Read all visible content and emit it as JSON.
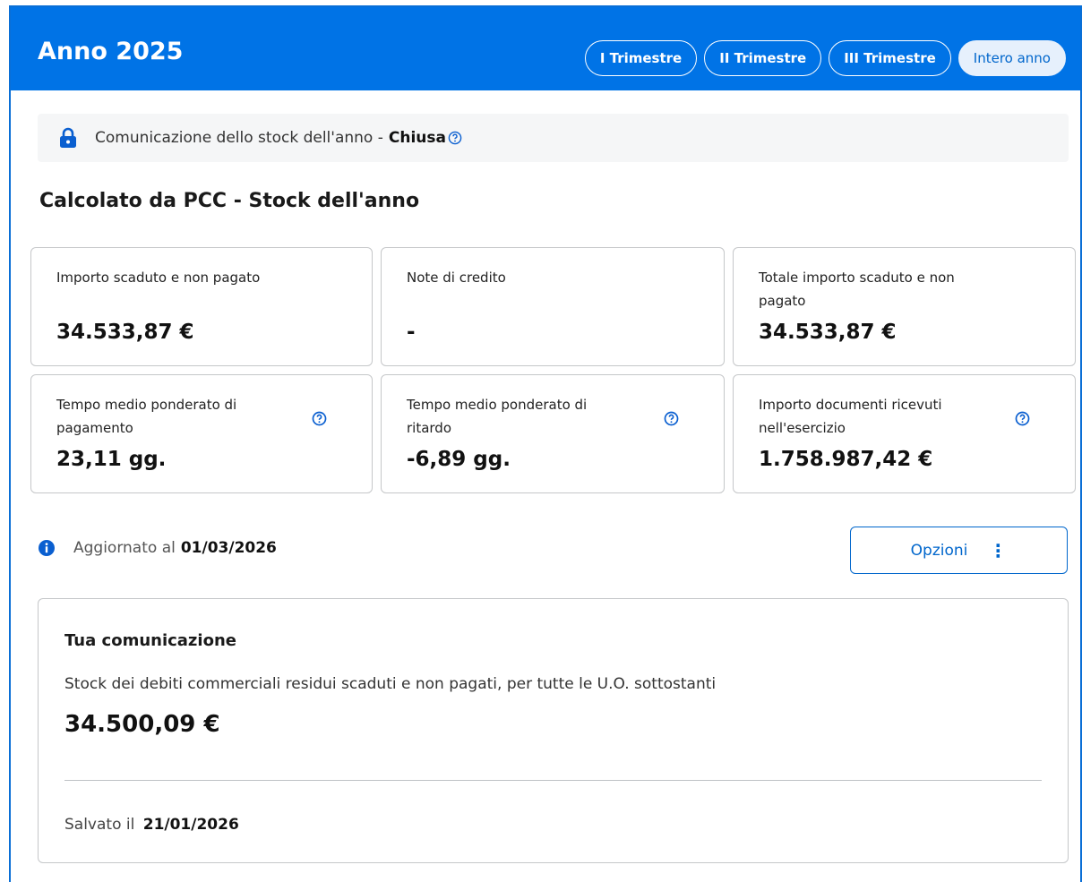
{
  "header": {
    "title": "Anno 2025",
    "tabs": [
      {
        "label": "I Trimestre",
        "active": false
      },
      {
        "label": "II Trimestre",
        "active": false
      },
      {
        "label": "III Trimestre",
        "active": false
      },
      {
        "label": "Intero anno",
        "active": true
      }
    ]
  },
  "status": {
    "text": "Comunicazione dello stock dell'anno -",
    "state": "Chiusa",
    "icon": "lock-icon"
  },
  "section_title": "Calcolato da PCC - Stock dell'anno",
  "cards": [
    {
      "label": "Importo scaduto e non pagato",
      "value": "34.533,87 €",
      "help": false
    },
    {
      "label": "Note di credito",
      "value": "-",
      "help": false
    },
    {
      "label": "Totale importo scaduto e non pagato",
      "value": "34.533,87 €",
      "help": false
    },
    {
      "label": "Tempo medio ponderato di pagamento",
      "value": "23,11 gg.",
      "help": true
    },
    {
      "label": "Tempo medio ponderato di ritardo",
      "value": "-6,89 gg.",
      "help": true
    },
    {
      "label": "Importo documenti ricevuti nell'esercizio",
      "value": "1.758.987,42 €",
      "help": true
    }
  ],
  "updated": {
    "label": "Aggiornato al",
    "date": "01/03/2026"
  },
  "options_button": {
    "label": "Opzioni",
    "icon": "kebab-icon"
  },
  "communication": {
    "title": "Tua comunicazione",
    "description": "Stock dei debiti commerciali residui scaduti e non pagati, per tutte le U.O. sottostanti",
    "amount": "34.500,09 €",
    "saved_label": "Salvato il",
    "saved_date": "21/01/2026"
  },
  "colors": {
    "primary": "#0073e6",
    "link": "#0066cc",
    "border": "#c5c7c9",
    "panel": "#f5f6f7"
  }
}
